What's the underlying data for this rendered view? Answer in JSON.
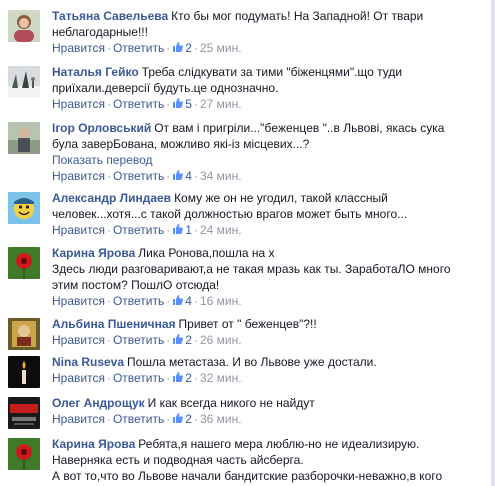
{
  "actions": {
    "like_label": "Нравится",
    "reply_label": "Ответить",
    "translate_label": "Показать перевод"
  },
  "comments": [
    {
      "author": "Татьяна Савельева",
      "text": "Кто бы мог подумать! На Западной! От твари\nнеблагодарные!!!",
      "likes": "2",
      "time": "25 мин.",
      "avatar": "avatar-woman-photo"
    },
    {
      "author": "Наталья Гейко",
      "text": "Треба слідкувати за тими \"біженцями\".що туди\nприїхали.деверсії будуть.це однозначно.",
      "likes": "5",
      "time": "27 мин.",
      "avatar": "avatar-winter-photo"
    },
    {
      "author": "Ігор Орловський",
      "text": "От вам і пригріли...\"бeженцeв \"..в Львові, якась сука\nбула заверБована, можливо які-із місцевих...?",
      "likes": "4",
      "time": "34 мин.",
      "avatar": "avatar-outdoor-photo",
      "translate": true
    },
    {
      "author": "Александр Линдаев",
      "text": "Кому же он не угодил, такой классный\nчеловек...хотя...с такой должностью врагов может быть много...",
      "likes": "1",
      "time": "24 мин.",
      "avatar": "avatar-cartoon-face"
    },
    {
      "author": "Карина Ярова",
      "text": "Лика Ронова,пошла на х\nЗдесь люди разговаривают,а не такая мразь как ты. ЗаработаЛО много\nэтим постом? ПошлО отсюда!",
      "likes": "4",
      "time": "16 мин.",
      "avatar": "avatar-red-flower"
    },
    {
      "author": "Альбина Пшеничная",
      "text": "Привет от \" беженцев\"?!!",
      "likes": "2",
      "time": "26 мин.",
      "avatar": "avatar-icon-picture"
    },
    {
      "author": "Nina Ruseva",
      "text": "Пошла метастаза. И во Львове уже достали.",
      "likes": "2",
      "time": "32 мин.",
      "avatar": "avatar-candle"
    },
    {
      "author": "Олег Андрощук",
      "text": "И как всегда никого не найдут",
      "likes": "2",
      "time": "36 мин.",
      "avatar": "avatar-banner"
    },
    {
      "author": "Карина Ярова",
      "text": "Ребята,я нашего мера люблю-но не идеализирую.\nНаверняка есть и подводная часть айсберга.\nА вот то,что во Львове начали бандитские разборочки-неважно,в кого",
      "avatar": "avatar-red-flower"
    }
  ]
}
